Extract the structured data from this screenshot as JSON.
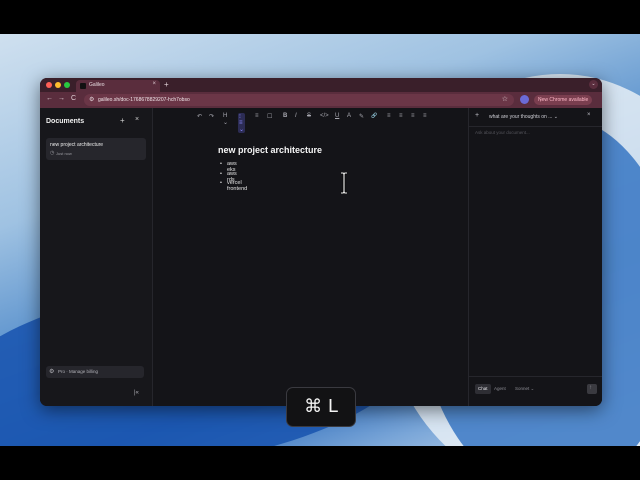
{
  "browser": {
    "tab_title": "Galileo",
    "tab_close": "×",
    "new_tab": "+",
    "tab_menu": "⌄",
    "nav_back": "←",
    "nav_forward": "→",
    "nav_reload": "C",
    "url": "galileo.sh/doc-1768678829207-hch7obso",
    "star": "☆",
    "update_label": "New Chrome available",
    "update_menu": "⋮"
  },
  "sidebar": {
    "title": "Documents",
    "add": "+",
    "close": "×",
    "documents": [
      {
        "title": "new project architecture",
        "time": "Just now"
      }
    ],
    "billing_label": "Pro · Manage billing",
    "collapse": "|«"
  },
  "toolbar": {
    "items": [
      "↶",
      "↷",
      "H ⌄",
      "⁝≡ ⌄",
      "≡",
      "☐",
      "B",
      "I",
      "S",
      "</>",
      "U",
      "A",
      "✎",
      "🔗",
      "≡",
      "≡",
      "≡",
      "≡"
    ]
  },
  "document": {
    "title": "new project architecture",
    "bullets": [
      "aws eks",
      "aws rds",
      "vercel frontend"
    ]
  },
  "chat": {
    "new": "+",
    "title": "what are your thoughts on ... ⌄",
    "close": "×",
    "placeholder": "Ask about your document...",
    "mode_chat": "Chat",
    "mode_agent": "Agent",
    "model": "Sonnet ⌄",
    "send": "↑"
  },
  "overlay": {
    "shortcut": "⌘ L"
  },
  "colors": {
    "tabbar": "#3a1f2a",
    "urlbar": "#5a2d3d",
    "app_bg": "#141418",
    "accent": "#8a8aff"
  }
}
